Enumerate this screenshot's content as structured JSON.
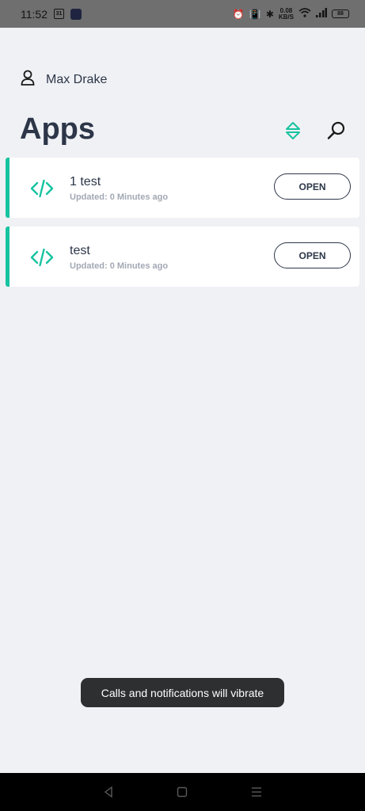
{
  "status_bar": {
    "time": "11:52",
    "calendar_day": "31",
    "speed_value": "0.08",
    "speed_unit": "KB/S",
    "battery": "88"
  },
  "user": {
    "name": "Max Drake"
  },
  "header": {
    "title": "Apps"
  },
  "apps": [
    {
      "name": "1 test",
      "updated": "Updated: 0 Minutes ago",
      "button": "OPEN"
    },
    {
      "name": "test",
      "updated": "Updated: 0 Minutes ago",
      "button": "OPEN"
    }
  ],
  "toast": {
    "message": "Calls and notifications will vibrate"
  },
  "colors": {
    "accent": "#17c3a0",
    "text": "#2c3648",
    "background": "#f0f1f5"
  },
  "icons": [
    "user-icon",
    "sort-icon",
    "search-icon",
    "code-icon",
    "back-icon",
    "home-icon",
    "recents-icon"
  ]
}
